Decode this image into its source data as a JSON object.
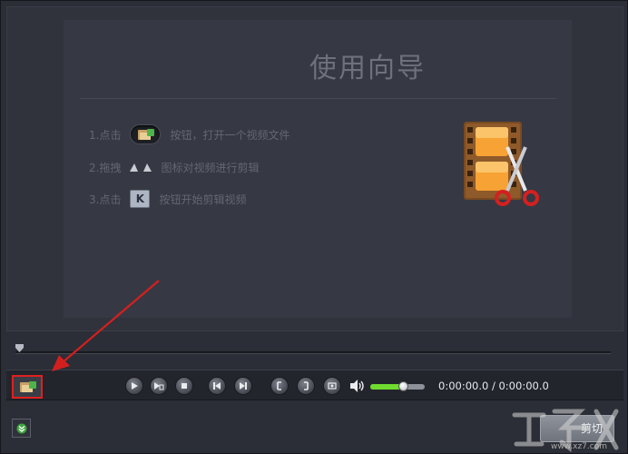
{
  "guide": {
    "title": "使用向导",
    "steps": [
      {
        "prefix": "1.点击",
        "suffix": "按钮，打开一个视频文件",
        "icon": "open-file-icon"
      },
      {
        "prefix": "2.拖拽",
        "suffix": "图标对视频进行剪辑",
        "icon": "trim-markers-icon"
      },
      {
        "prefix": "3.点击",
        "suffix": "按钮开始剪辑视频",
        "icon": "cut-icon"
      }
    ],
    "illustration": "film-scissors-icon"
  },
  "timeline": {
    "position": 0
  },
  "controls": {
    "buttons": [
      "play-icon",
      "play-selection-icon",
      "stop-icon",
      "previous-icon",
      "next-icon",
      "mark-start-icon",
      "mark-end-icon",
      "snapshot-icon"
    ],
    "volume": 0.6,
    "time_display": "0:00:00.0 / 0:00:00.0"
  },
  "bottom": {
    "cut_label": "剪切"
  },
  "watermark": {
    "text": "www.xz7.com"
  },
  "colors": {
    "highlight": "#e11f1f",
    "volume_fill": "#6edb2e",
    "annotation_arrow": "#d41f1f"
  }
}
